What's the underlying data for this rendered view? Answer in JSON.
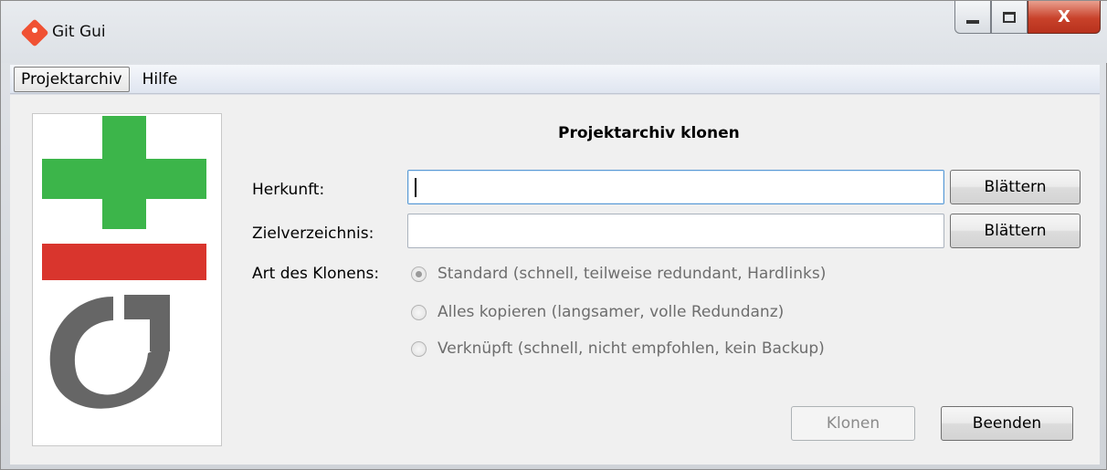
{
  "window": {
    "title": "Git Gui",
    "controls": {
      "minimize": "minimize-icon",
      "maximize": "maximize-icon",
      "close": "X"
    }
  },
  "menubar": {
    "items": [
      {
        "label": "Projektarchiv",
        "active": true
      },
      {
        "label": "Hilfe",
        "active": false
      }
    ]
  },
  "dialog": {
    "heading": "Projektarchiv klonen",
    "source": {
      "label": "Herkunft:",
      "value": "",
      "browse_label": "Blättern"
    },
    "target": {
      "label": "Zielverzeichnis:",
      "value": "",
      "browse_label": "Blättern"
    },
    "clone_type": {
      "label": "Art des Klonens:",
      "options": [
        {
          "label": "Standard (schnell, teilweise redundant, Hardlinks)",
          "checked": true
        },
        {
          "label": "Alles kopieren (langsamer, volle Redundanz)",
          "checked": false
        },
        {
          "label": "Verknüpft (schnell, nicht empfohlen, kein Backup)",
          "checked": false
        }
      ]
    },
    "clone_button": {
      "label": "Klonen",
      "enabled": false
    },
    "quit_button": {
      "label": "Beenden",
      "enabled": true
    }
  },
  "logo": {
    "colors": {
      "plus": "#3cb54a",
      "bar": "#d9352d",
      "arrow": "#666666"
    }
  }
}
